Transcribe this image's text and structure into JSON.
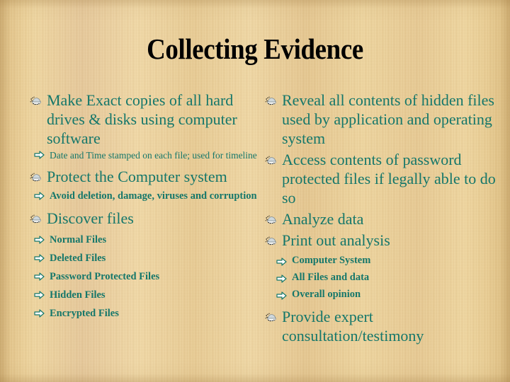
{
  "slide": {
    "title": "Collecting Evidence",
    "theme": {
      "background_name": "papyrus-texture",
      "background_color": "#ecd49c",
      "title_color": "#000000",
      "body_text_color": "#15776a",
      "bullet_icon": "speckled-blob-picture-bullet",
      "sub_bullet_icon": "right-block-arrow"
    },
    "columns": {
      "left": [
        {
          "text": "Make Exact copies of all hard drives & disks using computer software",
          "sub": [
            {
              "text": "Date and Time stamped on each file; used for timeline",
              "bold": false
            }
          ]
        },
        {
          "text": "Protect the Computer system",
          "sub": [
            {
              "text": "Avoid deletion, damage, viruses and corruption",
              "bold": true
            }
          ]
        },
        {
          "text": "Discover files",
          "sub": [
            {
              "text": "Normal Files",
              "bold": true
            },
            {
              "text": "Deleted Files",
              "bold": true
            },
            {
              "text": "Password Protected Files",
              "bold": true
            },
            {
              "text": "Hidden Files",
              "bold": true
            },
            {
              "text": "Encrypted Files",
              "bold": true
            }
          ]
        }
      ],
      "right": [
        {
          "text": "Reveal all contents of hidden files used by application and operating system",
          "sub": []
        },
        {
          "text": "Access contents of password protected files if legally able to do so",
          "sub": []
        },
        {
          "text": "Analyze data",
          "sub": []
        },
        {
          "text": "Print out analysis",
          "sub": [
            {
              "text": "Computer System",
              "bold": true
            },
            {
              "text": "All Files and data",
              "bold": true
            },
            {
              "text": "Overall opinion",
              "bold": true
            }
          ]
        },
        {
          "text": "Provide expert consultation/testimony",
          "sub": []
        }
      ]
    }
  }
}
